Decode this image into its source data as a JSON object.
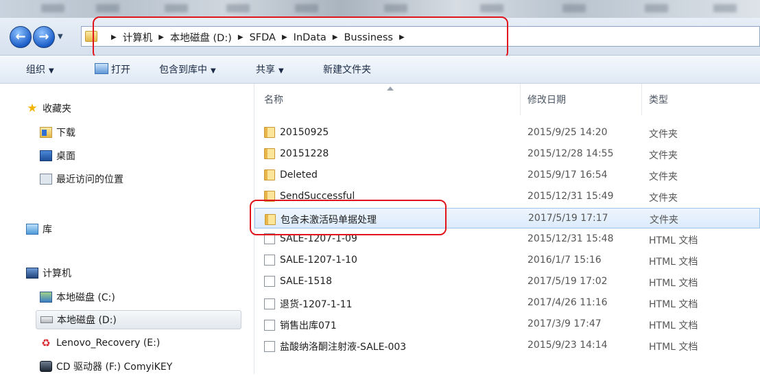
{
  "breadcrumbs": [
    "计算机",
    "本地磁盘 (D:)",
    "SFDA",
    "InData",
    "Bussiness"
  ],
  "toolbar": {
    "organize": "组织",
    "open": "打开",
    "include_library": "包含到库中",
    "share": "共享",
    "new_folder": "新建文件夹"
  },
  "nav": {
    "favorites": "收藏夹",
    "downloads": "下载",
    "desktop": "桌面",
    "recent": "最近访问的位置",
    "libraries": "库",
    "computer": "计算机",
    "drive_c": "本地磁盘 (C:)",
    "drive_d": "本地磁盘 (D:)",
    "drive_e": "Lenovo_Recovery (E:)",
    "drive_f": "CD 驱动器 (F:) ComyiKEY"
  },
  "columns": {
    "name": "名称",
    "date": "修改日期",
    "type": "类型"
  },
  "files": [
    {
      "name": "20150925",
      "date": "2015/9/25 14:20",
      "type": "文件夹",
      "icon": "folder-icon"
    },
    {
      "name": "20151228",
      "date": "2015/12/28 14:55",
      "type": "文件夹",
      "icon": "folder-icon"
    },
    {
      "name": "Deleted",
      "date": "2015/9/17 16:54",
      "type": "文件夹",
      "icon": "folder-icon"
    },
    {
      "name": "SendSuccessful",
      "date": "2015/12/31 15:49",
      "type": "文件夹",
      "icon": "folder-icon"
    },
    {
      "name": "包含未激活码单据处理",
      "date": "2017/5/19 17:17",
      "type": "文件夹",
      "icon": "folder-icon",
      "selected": true
    },
    {
      "name": "SALE-1207-1-09",
      "date": "2015/12/31 15:48",
      "type": "HTML 文档",
      "icon": "file-icon"
    },
    {
      "name": "SALE-1207-1-10",
      "date": "2016/1/7 15:16",
      "type": "HTML 文档",
      "icon": "file-icon"
    },
    {
      "name": "SALE-1518",
      "date": "2017/5/19 17:02",
      "type": "HTML 文档",
      "icon": "file-icon"
    },
    {
      "name": "退货-1207-1-11",
      "date": "2017/4/26 11:16",
      "type": "HTML 文档",
      "icon": "file-icon"
    },
    {
      "name": "销售出库071",
      "date": "2017/3/9 17:47",
      "type": "HTML 文档",
      "icon": "file-icon"
    },
    {
      "name": "盐酸纳洛酮注射液-SALE-003",
      "date": "2015/9/23 14:14",
      "type": "HTML 文档",
      "icon": "file-icon"
    }
  ],
  "colors": {
    "highlight": "#e0141a",
    "selection": "#dcebfb"
  }
}
